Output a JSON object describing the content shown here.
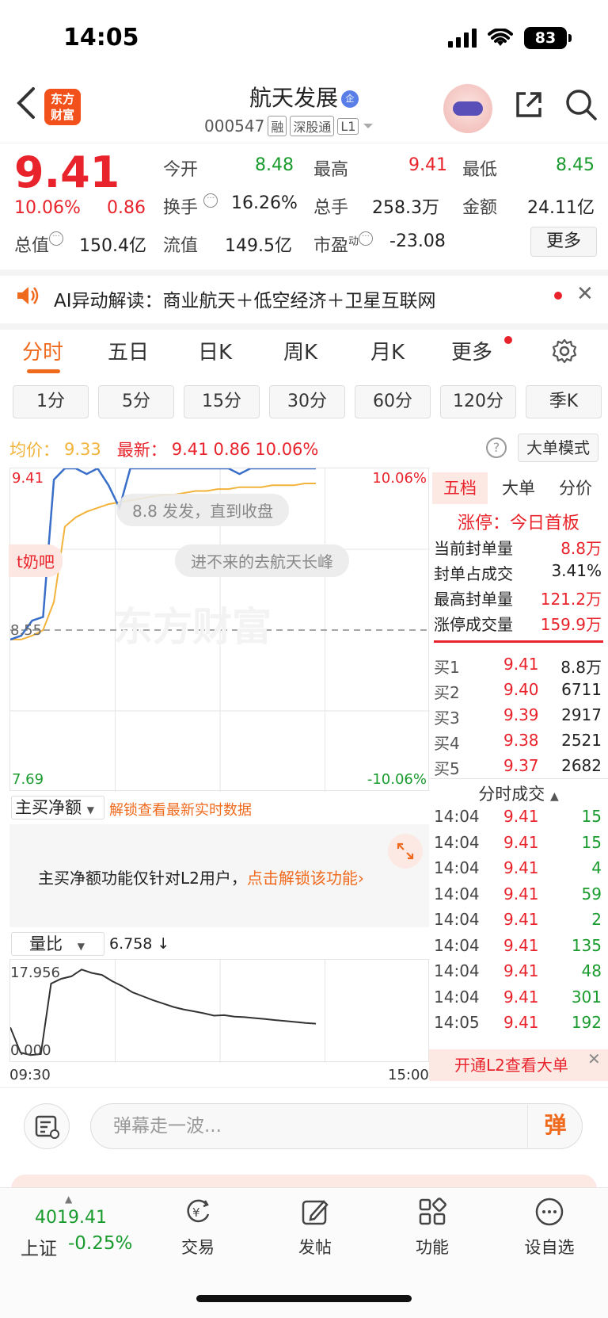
{
  "status": {
    "time": "14:05",
    "battery": "83"
  },
  "nav": {
    "title": "航天发展",
    "title_badge": "企",
    "code": "000547",
    "tags": [
      "融",
      "深股通",
      "L1"
    ],
    "logo_line1": "东方",
    "logo_line2": "财富"
  },
  "quote": {
    "price": "9.41",
    "pct": "10.06%",
    "change": "0.86",
    "open_label": "今开",
    "open": "8.48",
    "high_label": "最高",
    "high": "9.41",
    "low_label": "最低",
    "low": "8.45",
    "turnover_label": "换手",
    "turnover": "16.26%",
    "volume_label": "总手",
    "volume": "258.3万",
    "amount_label": "金额",
    "amount": "24.11亿",
    "mktcap_label": "总值",
    "mktcap": "150.4亿",
    "float_label": "流值",
    "float": "149.5亿",
    "pe_label": "市盈",
    "pe_sup": "动",
    "pe": "-23.08",
    "more": "更多"
  },
  "ai_bar": {
    "text": "AI异动解读：商业航天＋低空经济＋卫星互联网"
  },
  "tabs": [
    "分时",
    "五日",
    "日K",
    "周K",
    "月K",
    "更多"
  ],
  "periods": [
    "1分",
    "5分",
    "15分",
    "30分",
    "60分",
    "120分",
    "季K"
  ],
  "info_line": {
    "avg_label": "均价：",
    "avg": "9.33",
    "latest_label": "最新：",
    "latest": "9.41",
    "latest_chg": "0.86",
    "latest_pct": "10.06%",
    "help": "?",
    "big_order_mode": "大单模式"
  },
  "chart": {
    "y_top_left": "9.41",
    "y_mid_left": "8.55",
    "y_bottom_left": "7.69",
    "y_top_right": "10.06%",
    "y_bottom_right": "-10.06%",
    "bubble1": "8.8 发发，直到收盘",
    "bubble2": "进不来的去航天长峰",
    "side_bubble": "t奶吧",
    "watermark": "东方财富"
  },
  "chart_data": {
    "type": "line",
    "ylim": [
      7.69,
      9.41
    ],
    "x_range": [
      "09:30",
      "15:00"
    ],
    "series": [
      {
        "values": [
          8.5,
          8.52,
          8.6,
          8.62,
          9.35,
          9.41,
          9.41,
          9.38,
          9.41,
          9.32,
          9.2,
          9.41,
          9.41,
          9.41,
          9.41,
          9.41,
          9.41,
          9.41,
          9.41,
          9.41,
          9.41,
          9.38,
          9.41,
          9.41,
          9.41,
          9.41,
          9.41,
          9.41,
          9.41
        ]
      },
      {
        "values": [
          8.5,
          8.5,
          8.52,
          8.55,
          8.7,
          9.1,
          9.15,
          9.18,
          9.2,
          9.22,
          9.23,
          9.24,
          9.25,
          9.26,
          9.27,
          9.27,
          9.28,
          9.29,
          9.29,
          9.3,
          9.3,
          9.31,
          9.31,
          9.31,
          9.32,
          9.32,
          9.32,
          9.33,
          9.33
        ]
      }
    ]
  },
  "order_panel": {
    "tabs": [
      "五档",
      "大单",
      "分价"
    ],
    "limit_up_title": "涨停：今日首板",
    "stats": [
      {
        "label": "当前封单量",
        "value": "8.8万"
      },
      {
        "label": "封单占成交",
        "value": "3.41%"
      },
      {
        "label": "最高封单量",
        "value": "121.2万"
      },
      {
        "label": "涨停成交量",
        "value": "159.9万"
      }
    ],
    "bids": [
      {
        "label": "买1",
        "price": "9.41",
        "vol": "8.8万"
      },
      {
        "label": "买2",
        "price": "9.40",
        "vol": "6711"
      },
      {
        "label": "买3",
        "price": "9.39",
        "vol": "2917"
      },
      {
        "label": "买4",
        "price": "9.38",
        "vol": "2521"
      },
      {
        "label": "买5",
        "price": "9.37",
        "vol": "2682"
      }
    ],
    "tick_title": "分时成交",
    "ticks": [
      {
        "time": "14:04",
        "price": "9.41",
        "vol": "15"
      },
      {
        "time": "14:04",
        "price": "9.41",
        "vol": "15"
      },
      {
        "time": "14:04",
        "price": "9.41",
        "vol": "4"
      },
      {
        "time": "14:04",
        "price": "9.41",
        "vol": "59"
      },
      {
        "time": "14:04",
        "price": "9.41",
        "vol": "2"
      },
      {
        "time": "14:04",
        "price": "9.41",
        "vol": "135"
      },
      {
        "time": "14:04",
        "price": "9.41",
        "vol": "48"
      },
      {
        "time": "14:04",
        "price": "9.41",
        "vol": "301"
      },
      {
        "time": "14:05",
        "price": "9.41",
        "vol": "192"
      }
    ],
    "l2_text": "开通L2查看大单"
  },
  "net_buy": {
    "select": "主买净额",
    "unlock": "解锁查看最新实时数据",
    "msg": "主买净额功能仅针对L2用户，",
    "msg_link": "点击解锁该功能"
  },
  "volume_ratio": {
    "select": "量比",
    "value": "6.758 ↓",
    "y_top": "17.956",
    "y_bottom": "0.000",
    "time_start": "09:30",
    "time_end": "15:00",
    "values": [
      6,
      0.8,
      0.3,
      0.5,
      15,
      16,
      16.5,
      17.9,
      17.2,
      16.8,
      15.5,
      14.5,
      13.2,
      12.4,
      11.6,
      10.9,
      10.2,
      9.7,
      9.3,
      8.9,
      8.4,
      8.5,
      8.2,
      8.1,
      7.9,
      7.7,
      7.5,
      7.3,
      7.1,
      6.9,
      6.76
    ]
  },
  "danmaku": {
    "placeholder": "弹幕走一波...",
    "send": "弹"
  },
  "bottom_bar": {
    "index_value": "4019.41",
    "index_name": "上证",
    "index_pct": "-0.25%",
    "tabs": [
      "交易",
      "发帖",
      "功能",
      "设自选"
    ]
  },
  "colors": {
    "up": "#e8232b",
    "down": "#1a9b2e",
    "accent": "#f06a1e",
    "price_line": "#3a6fc9",
    "avg_line": "#f2b33a"
  }
}
